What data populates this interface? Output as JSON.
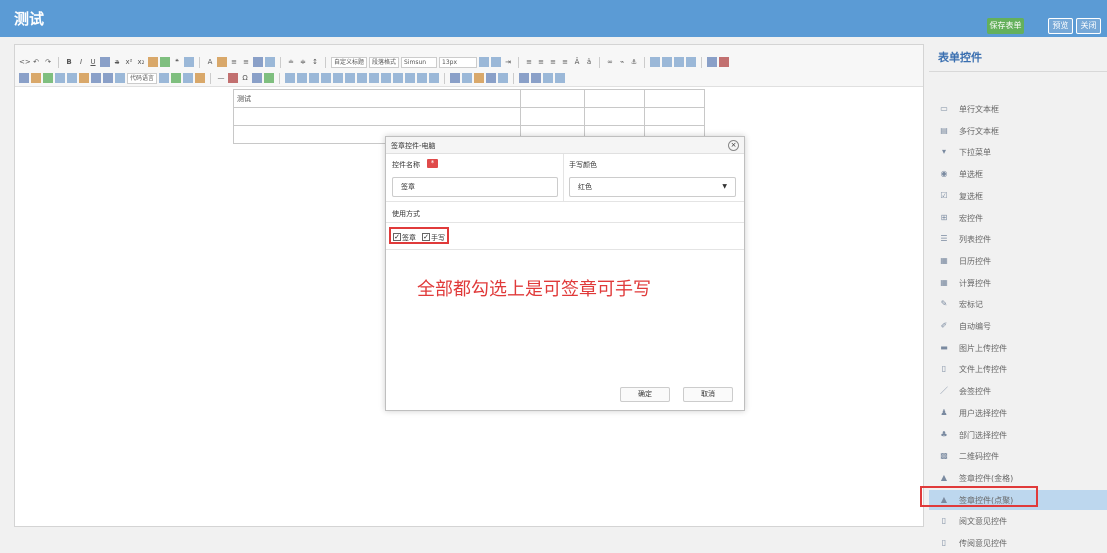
{
  "header": {
    "title": "测试",
    "save_label": "保存表单",
    "preview_label": "预览",
    "close_label": "关闭"
  },
  "toolbar": {
    "selects": [
      "自定义标题",
      "段落格式",
      "Simsun",
      "13px"
    ],
    "code_lang": "代码语言"
  },
  "doc": {
    "cell": "测试"
  },
  "dialog": {
    "title": "签章控件-电脑",
    "close": "×",
    "name_label": "控件名称",
    "required_mark": "*",
    "color_label": "手写颜色",
    "name_value": "签章",
    "color_value": "红色",
    "usage_label": "使用方式",
    "opt_stamp": "签章",
    "opt_hand": "手写",
    "ok": "确定",
    "cancel": "取消"
  },
  "annotation": "全部都勾选上是可签章可手写",
  "sidebar": {
    "title": "表单控件",
    "items": [
      {
        "icon": "textbox-icon",
        "label": "单行文本框"
      },
      {
        "icon": "textarea-icon",
        "label": "多行文本框"
      },
      {
        "icon": "dropdown-icon",
        "label": "下拉菜单"
      },
      {
        "icon": "radio-icon",
        "label": "单选框"
      },
      {
        "icon": "checkbox-icon",
        "label": "复选框"
      },
      {
        "icon": "macro-icon",
        "label": "宏控件"
      },
      {
        "icon": "list-icon",
        "label": "列表控件"
      },
      {
        "icon": "calendar-icon",
        "label": "日历控件"
      },
      {
        "icon": "calc-icon",
        "label": "计算控件"
      },
      {
        "icon": "macro-mark-icon",
        "label": "宏标记"
      },
      {
        "icon": "auto-number-icon",
        "label": "自动编号"
      },
      {
        "icon": "image-upload-icon",
        "label": "图片上传控件"
      },
      {
        "icon": "file-upload-icon",
        "label": "文件上传控件"
      },
      {
        "icon": "countersign-icon",
        "label": "会签控件"
      },
      {
        "icon": "user-select-icon",
        "label": "用户选择控件"
      },
      {
        "icon": "dept-select-icon",
        "label": "部门选择控件"
      },
      {
        "icon": "qrcode-icon",
        "label": "二维码控件"
      },
      {
        "icon": "stamp-icon",
        "label": "签章控件(金格)"
      },
      {
        "icon": "stamp-icon",
        "label": "签章控件(点聚)"
      },
      {
        "icon": "opinion-icon",
        "label": "阅文意见控件"
      },
      {
        "icon": "opinion-icon",
        "label": "传阅意见控件"
      }
    ]
  }
}
